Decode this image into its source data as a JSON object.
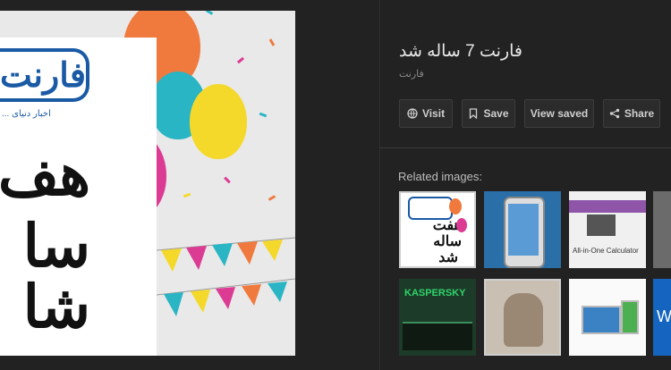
{
  "preview": {
    "poster": {
      "logo_text": "فارنت",
      "logo_sub": "اخبار دنیای ...",
      "words": [
        "هف",
        "سا",
        "شا"
      ]
    }
  },
  "details": {
    "title": "فارنت 7 ساله شد",
    "source": "فارنت",
    "buttons": {
      "visit": "Visit",
      "save": "Save",
      "view_saved": "View saved",
      "share": "Share"
    },
    "related_label": "Related images:",
    "related": [
      {
        "name": "farnet-poster",
        "caption_lines": [
          "هفت",
          "ساله",
          "شد"
        ]
      },
      {
        "name": "samsung-phone"
      },
      {
        "name": "calculator-app",
        "caption": "All-in-One Calculator"
      },
      {
        "name": "edge-partial"
      },
      {
        "name": "kaspersky",
        "caption": "KASPERSKY"
      },
      {
        "name": "figurine"
      },
      {
        "name": "devices"
      },
      {
        "name": "windows-partial",
        "caption": "W"
      }
    ]
  },
  "colors": {
    "background": "#222222",
    "logo_blue": "#1a5aa5"
  }
}
